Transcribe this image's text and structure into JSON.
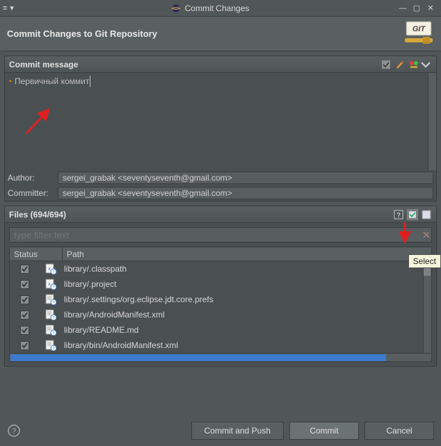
{
  "window": {
    "title": "Commit Changes",
    "menu_glyph": "≡",
    "menu_dropdown": "▾",
    "minimize": "—",
    "maximize": "▢",
    "close": "✕"
  },
  "header": {
    "title": "Commit Changes to Git Repository",
    "git_label": "GIT"
  },
  "commit_message": {
    "section_title": "Commit message",
    "text": "Первичный коммит",
    "icons": {
      "amend": "amend-icon",
      "signoff": "signoff-icon",
      "gerrit": "gerrit-icon"
    }
  },
  "author": {
    "label": "Author:",
    "value": "sergei_grabak <seventyseventh@gmail.com>"
  },
  "committer": {
    "label": "Committer:",
    "value": "sergei_grabak <seventyseventh@gmail.com>"
  },
  "files": {
    "section_title": "Files (694/694)",
    "filter_placeholder": "type filter text",
    "columns": {
      "status": "Status",
      "path": "Path"
    },
    "rows": [
      {
        "checked": true,
        "icon": "xml-q",
        "path": "library/.classpath"
      },
      {
        "checked": true,
        "icon": "xml-q",
        "path": "library/.project"
      },
      {
        "checked": true,
        "icon": "file-q",
        "path": "library/.settings/org.eclipse.jdt.core.prefs"
      },
      {
        "checked": true,
        "icon": "file-q",
        "path": "library/AndroidManifest.xml"
      },
      {
        "checked": true,
        "icon": "file-q",
        "path": "library/README.md"
      },
      {
        "checked": true,
        "icon": "file-q",
        "path": "library/bin/AndroidManifest.xml"
      }
    ],
    "tooltip": "Select"
  },
  "buttons": {
    "commit_push": "Commit and Push",
    "commit": "Commit",
    "cancel": "Cancel"
  }
}
